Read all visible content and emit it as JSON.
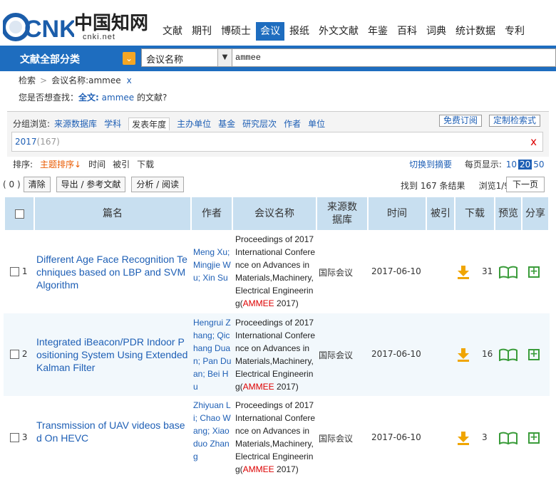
{
  "logo": {
    "cn": "中国知网",
    "url": "cnki.net",
    "brand": "CNKI"
  },
  "nav": [
    "文献",
    "期刊",
    "博硕士",
    "会议",
    "报纸",
    "外文文献",
    "年鉴",
    "百科",
    "词典",
    "统计数据",
    "专利"
  ],
  "search": {
    "category_label": "文献全部分类",
    "field": "会议名称",
    "query": "ammee"
  },
  "breadcrumb": {
    "root": "检索",
    "current": "会议名称:ammee",
    "remove": "x"
  },
  "suggest": {
    "prefix": "您是否想查找：",
    "type": "全文:",
    "term": "ammee",
    "suffix": " 的文献?"
  },
  "group": {
    "lead": "分组浏览:",
    "tabs": [
      "来源数据库",
      "学科",
      "发表年度",
      "主办单位",
      "基金",
      "研究层次",
      "作者",
      "单位"
    ],
    "subscribe": "免费订阅",
    "custom": "定制检索式",
    "year": "2017",
    "year_count": "(167)",
    "close": "x"
  },
  "sort": {
    "lead": "排序:",
    "options": [
      "主题排序↓",
      "时间",
      "被引",
      "下载"
    ],
    "switch": "切换到摘要",
    "per_page_label": "每页显示:",
    "per_page": [
      "10",
      "20",
      "50"
    ]
  },
  "toolbar": {
    "count": "( 0 )",
    "clear": "清除",
    "export": "导出 / 参考文献",
    "analyze": "分析 / 阅读",
    "found": "找到 167 条结果",
    "browse": "浏览1/9",
    "next": "下一页"
  },
  "columns": [
    "篇名",
    "作者",
    "会议名称",
    "来源数据库",
    "时间",
    "被引",
    "下载",
    "预览",
    "分享"
  ],
  "rows": [
    {
      "num": "1",
      "title": "Different Age Face Recognition Techniques based on LBP and SVM Algorithm",
      "authors": "Meng Xu; Mingjie Wu; Xin Su",
      "conf_pre": "Proceedings of 2017 International Conference on Advances in Materials,Machinery,Electrical Engineering(",
      "conf_hl": "AMMEE",
      "conf_post": " 2017)",
      "db": "国际会议",
      "date": "2017-06-10",
      "downloads": "31"
    },
    {
      "num": "2",
      "title": "Integrated iBeacon/PDR Indoor Positioning System Using Extended Kalman Filter",
      "authors": "Hengrui Zhang; Qichang Duan; Pan Duan; Bei Hu",
      "conf_pre": "Proceedings of 2017 International Conference on Advances in Materials,Machinery,Electrical Engineering(",
      "conf_hl": "AMMEE",
      "conf_post": " 2017)",
      "db": "国际会议",
      "date": "2017-06-10",
      "downloads": "16"
    },
    {
      "num": "3",
      "title": "Transmission of UAV videos based On HEVC",
      "authors": "Zhiyuan Li; Chao Wang; Xiaoduo Zhang",
      "conf_pre": "Proceedings of 2017 International Conference on Advances in Materials,Machinery,Electrical Engineering(",
      "conf_hl": "AMMEE",
      "conf_post": " 2017)",
      "db": "国际会议",
      "date": "2017-06-10",
      "downloads": "3"
    }
  ],
  "colors": {
    "brand_blue": "#1e6dbf",
    "link_blue": "#1e5fb5",
    "header_cell": "#c8dff0",
    "row_alt": "#f2f8fc",
    "highlight": "#d00000",
    "orange": "#f5a623"
  }
}
